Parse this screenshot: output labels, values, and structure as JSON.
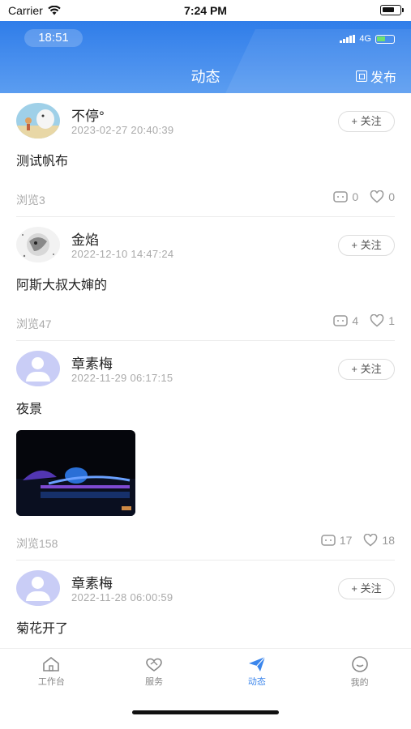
{
  "status_bar": {
    "carrier": "Carrier",
    "time": "7:24 PM"
  },
  "inner_status": {
    "time": "18:51",
    "network": "4G"
  },
  "header": {
    "title": "动态",
    "publish_label": "发布"
  },
  "posts": [
    {
      "author": "不停°",
      "time": "2023-02-27 20:40:39",
      "text": "测试帆布",
      "follow": "+ 关注",
      "views": "浏览3",
      "comments": "0",
      "likes": "0"
    },
    {
      "author": "金焰",
      "time": "2022-12-10 14:47:24",
      "text": "阿斯大叔大婶的",
      "follow": "+ 关注",
      "views": "浏览47",
      "comments": "4",
      "likes": "1"
    },
    {
      "author": "章素梅",
      "time": "2022-11-29 06:17:15",
      "text": "夜景",
      "follow": "+ 关注",
      "views": "浏览158",
      "comments": "17",
      "likes": "18"
    },
    {
      "author": "章素梅",
      "time": "2022-11-28 06:00:59",
      "text": "菊花开了",
      "follow": "+ 关注"
    }
  ],
  "tabs": [
    {
      "label": "工作台",
      "icon": "home-icon"
    },
    {
      "label": "服务",
      "icon": "handshake-icon"
    },
    {
      "label": "动态",
      "icon": "send-icon",
      "active": true
    },
    {
      "label": "我的",
      "icon": "smile-icon"
    }
  ],
  "colors": {
    "accent": "#3b86ec",
    "header_top": "#2f7de9",
    "header_bottom": "#5b9df0"
  }
}
